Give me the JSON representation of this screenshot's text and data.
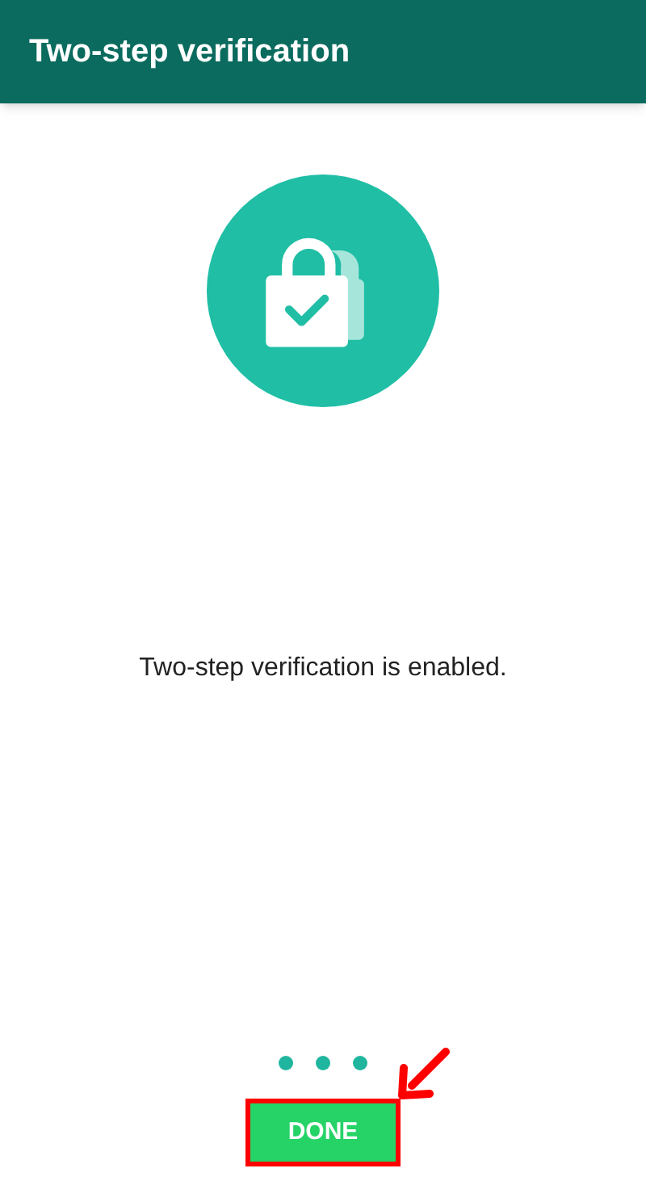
{
  "app_bar": {
    "title": "Two-step verification"
  },
  "message": "Two-step verification is enabled.",
  "button": {
    "label": "DONE"
  },
  "annotations": {
    "highlight_box": true,
    "arrow": true
  }
}
